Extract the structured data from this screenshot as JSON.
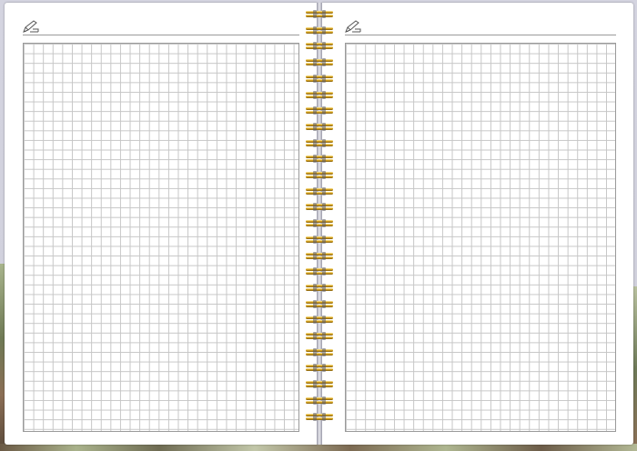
{
  "colors": {
    "page": "#ffffff",
    "grid_line": "#c6c6c6",
    "border": "#9a9a9a",
    "ring_gold": "#d9a21c",
    "ring_dark": "#7a5a10"
  },
  "pages": [
    {
      "icon": "pencil-icon"
    },
    {
      "icon": "pencil-icon"
    }
  ],
  "spiral": {
    "ring_count": 26
  }
}
